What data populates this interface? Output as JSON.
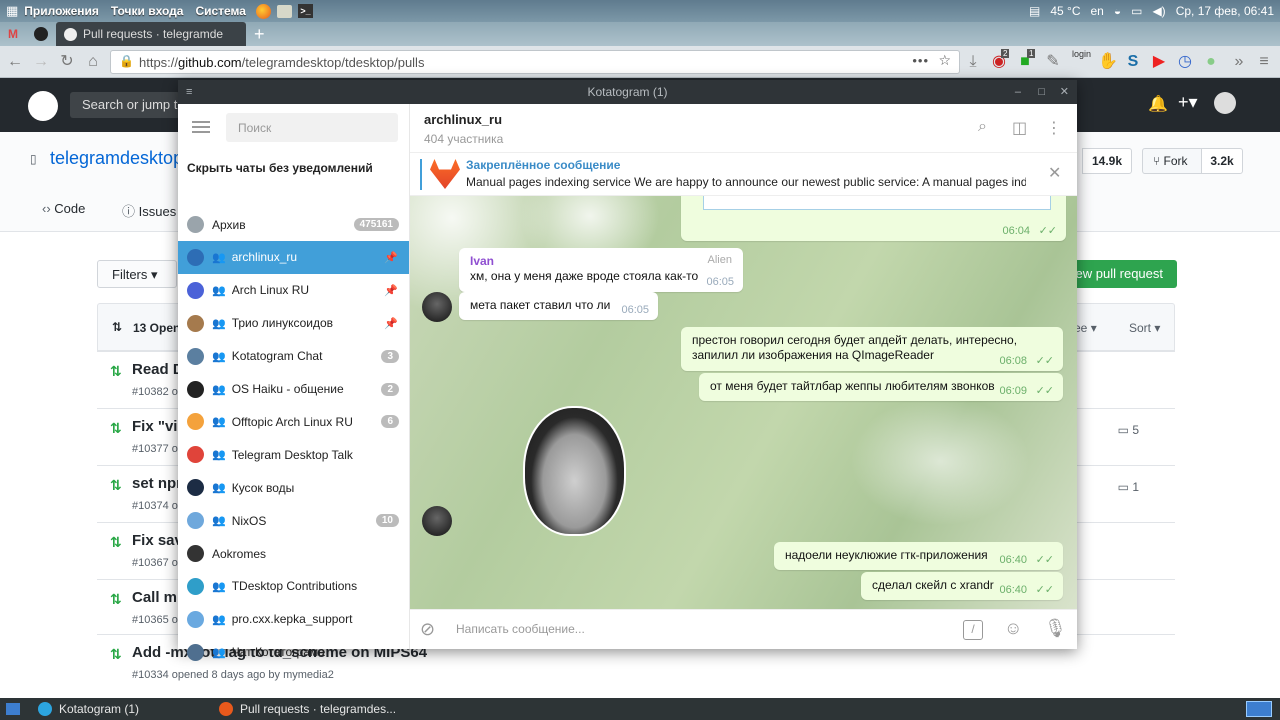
{
  "panel": {
    "menus": [
      "Приложения",
      "Точки входа",
      "Система"
    ],
    "temp": "45 °C",
    "lang": "en",
    "datetime": "Ср, 17 фев, 06:41"
  },
  "browser": {
    "tab_title": "Pull requests · telegramde",
    "url_prefix": "https://",
    "url_domain": "github.com",
    "url_path": "/telegramdesktop/tdesktop/pulls",
    "ext_label": "login",
    "badge_a": "2",
    "badge_b": "1"
  },
  "github": {
    "search_placeholder": "Search or jump to…",
    "repo": "telegramdesktop",
    "star_count": "14.9k",
    "fork_label": "Fork",
    "fork_count": "3.2k",
    "tabs": [
      "Code",
      "Issues"
    ],
    "filters_label": "Filters",
    "new_pr_label": "New pull request",
    "open_count": "13 Open",
    "sort_label": "Sort",
    "assignee_label": "ee",
    "prs": [
      {
        "title": "Read D",
        "sub": "#10382 o",
        "comments": ""
      },
      {
        "title": "Fix \"vi",
        "sub": "#10377 o",
        "comments": "5"
      },
      {
        "title": "set npr",
        "sub": "#10374 o",
        "comments": "1"
      },
      {
        "title": "Fix sav",
        "sub": "#10367 o",
        "comments": ""
      },
      {
        "title": "Call m",
        "sub": "#10365 o",
        "comments": ""
      },
      {
        "title": "Add -mxgot flag to td_scheme on MIPS64",
        "sub": "#10334 opened 8 days ago by mymedia2",
        "comments": ""
      }
    ]
  },
  "telegram": {
    "window_title": "Kotatogram (1)",
    "search_placeholder": "Поиск",
    "hide_muted": "Скрыть чаты без уведомлений",
    "chats": [
      {
        "name": "Архив",
        "badge": "475161",
        "group": false,
        "pin": false,
        "color": "#9aa4ab"
      },
      {
        "name": " archlinux_ru ",
        "badge": "",
        "group": true,
        "pin": true,
        "color": "#2d6db5"
      },
      {
        "name": "Arch Linux RU",
        "badge": "",
        "group": true,
        "pin": true,
        "color": "#4b62d8"
      },
      {
        "name": "Трио линуксоидов",
        "badge": "",
        "group": true,
        "pin": true,
        "color": "#a57a4d"
      },
      {
        "name": "Kotatogram Chat",
        "badge": "3",
        "group": true,
        "pin": false,
        "color": "#5b7fa0"
      },
      {
        "name": "OS Haiku - общение",
        "badge": "2",
        "group": true,
        "pin": false,
        "color": "#222222"
      },
      {
        "name": "Offtopic Arch Linux RU",
        "badge": "6",
        "group": true,
        "pin": false,
        "color": "#f4a23c"
      },
      {
        "name": "Telegram Desktop Talk",
        "badge": "",
        "group": true,
        "pin": false,
        "color": "#e0443a"
      },
      {
        "name": "Кусок воды",
        "badge": "",
        "group": true,
        "pin": false,
        "color": "#1c2c44"
      },
      {
        "name": "NixOS",
        "badge": "10",
        "group": true,
        "pin": false,
        "color": "#6fa8dc"
      },
      {
        "name": "Aokromes",
        "badge": "",
        "group": false,
        "pin": false,
        "color": "#333333"
      },
      {
        "name": "TDesktop Contributions",
        "badge": "",
        "group": true,
        "pin": false,
        "color": "#2f9ec9"
      },
      {
        "name": "pro.cxx.kepka_support",
        "badge": "",
        "group": true,
        "pin": false,
        "color": "#6aa9e0"
      },
      {
        "name": "Чат Котатограма",
        "badge": "",
        "group": true,
        "pin": false,
        "color": "#4f6f8f"
      }
    ],
    "header_title": " archlinux_ru ",
    "header_sub": "404 участника",
    "pinned_label": "Закреплённое сообщение",
    "pinned_text": "Manual pages indexing service  We are happy to announce our newest public service: A manual pages ind...",
    "messages": [
      {
        "text": "",
        "time": "06:04",
        "out": true
      },
      {
        "sender": "Ivan",
        "tag": "Alien",
        "text": "хм, она у меня даже вроде стояла как-то",
        "time": "06:05",
        "out": false
      },
      {
        "text": "мета пакет ставил что ли",
        "time": "06:05",
        "out": false
      },
      {
        "text": "престон говорил сегодня будет апдейт делать, интересно, запилил ли изображения на QImageReader",
        "time": "06:08",
        "out": true
      },
      {
        "text": "от меня будет тайтлбар жеппы любителям звонков",
        "time": "06:09",
        "out": true
      },
      {
        "text": "надоели неуклюжие гтк-приложения",
        "time": "06:40",
        "out": true
      },
      {
        "text": "сделал скейл с xrandr",
        "time": "06:40",
        "out": true
      }
    ],
    "input_placeholder": "Написать сообщение..."
  },
  "taskbar": {
    "items": [
      "Kotatogram (1)",
      "Pull requests · telegramdes..."
    ]
  }
}
